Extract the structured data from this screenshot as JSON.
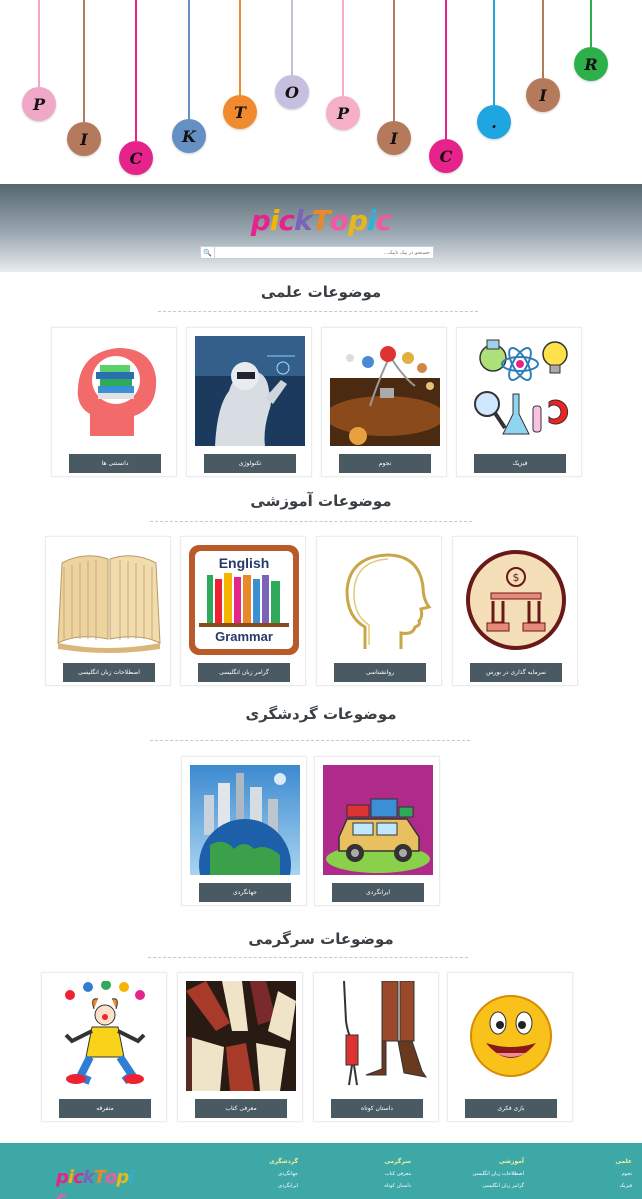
{
  "banner": {
    "letters": [
      {
        "ch": "P",
        "color": "#f0a8c8"
      },
      {
        "ch": "I",
        "color": "#b57a5c"
      },
      {
        "ch": "C",
        "color": "#e6238a"
      },
      {
        "ch": "K",
        "color": "#6590c4"
      },
      {
        "ch": "T",
        "color": "#f08a2c"
      },
      {
        "ch": "O",
        "color": "#c6bfe0"
      },
      {
        "ch": "P",
        "color": "#f5b0c8"
      },
      {
        "ch": "I",
        "color": "#b57a5c"
      },
      {
        "ch": "C",
        "color": "#e6238a"
      },
      {
        "ch": ".",
        "color": "#1fa6e0"
      },
      {
        "ch": "I",
        "color": "#b57a5c"
      },
      {
        "ch": "R",
        "color": "#2db04a"
      }
    ]
  },
  "logo": {
    "letters": [
      {
        "ch": "p",
        "color": "#e6238a"
      },
      {
        "ch": "i",
        "color": "#f5b400"
      },
      {
        "ch": "c",
        "color": "#e6238a"
      },
      {
        "ch": "k",
        "color": "#7a63b8"
      },
      {
        "ch": "T",
        "color": "#e98a2a"
      },
      {
        "ch": "o",
        "color": "#ef5aa0"
      },
      {
        "ch": "p",
        "color": "#e5b820"
      },
      {
        "ch": "i",
        "color": "#2eb0d8"
      },
      {
        "ch": "c",
        "color": "#ef5aa0"
      }
    ]
  },
  "search": {
    "placeholder": "جستجو در پیک تاپیک...",
    "button": "🔍"
  },
  "sections": [
    {
      "title": "موضوعات علمی",
      "cards": [
        {
          "label": "فیزیک",
          "img": "physics-image"
        },
        {
          "label": "نجوم",
          "img": "astronomy-image"
        },
        {
          "label": "تکنولوژی",
          "img": "technology-image"
        },
        {
          "label": "دانستنی ها",
          "img": "knowledge-image"
        }
      ]
    },
    {
      "title": "موضوعات آموزشی",
      "cards": [
        {
          "label": "سرمایه گذاری در بورس",
          "img": "stock-investment-image"
        },
        {
          "label": "روانشناسی",
          "img": "psychology-image"
        },
        {
          "label": "گرامر زبان انگلیسی",
          "img": "english-grammar-image",
          "book_top": "English",
          "book_bottom": "Grammar"
        },
        {
          "label": "اصطلاحات زبان انگلیسی",
          "img": "english-idioms-image"
        }
      ]
    },
    {
      "title": "موضوعات گردشگری",
      "cards": [
        {
          "label": "ایرانگردی",
          "img": "iran-tourism-image"
        },
        {
          "label": "جهانگردی",
          "img": "world-tourism-image"
        }
      ]
    },
    {
      "title": "موضوعات سرگرمی",
      "cards": [
        {
          "label": "بازی فکری",
          "img": "brain-games-image"
        },
        {
          "label": "داستان کوتاه",
          "img": "short-story-image"
        },
        {
          "label": "معرفی کتاب",
          "img": "book-intro-image"
        },
        {
          "label": "متفرقه",
          "img": "misc-image"
        }
      ]
    }
  ],
  "footer": {
    "cols": [
      {
        "title": "علمی",
        "items": [
          "نجوم",
          "فیزیک"
        ]
      },
      {
        "title": "آموزشی",
        "items": [
          "اصطلاحات زبان انگلیسی",
          "گرامر زبان انگلیسی"
        ]
      },
      {
        "title": "سرگرمی",
        "items": [
          "معرفی کتاب",
          "داستان کوتاه"
        ]
      },
      {
        "title": "گردشگری",
        "items": [
          "جهانگردی",
          "ایرانگردی"
        ]
      }
    ]
  }
}
